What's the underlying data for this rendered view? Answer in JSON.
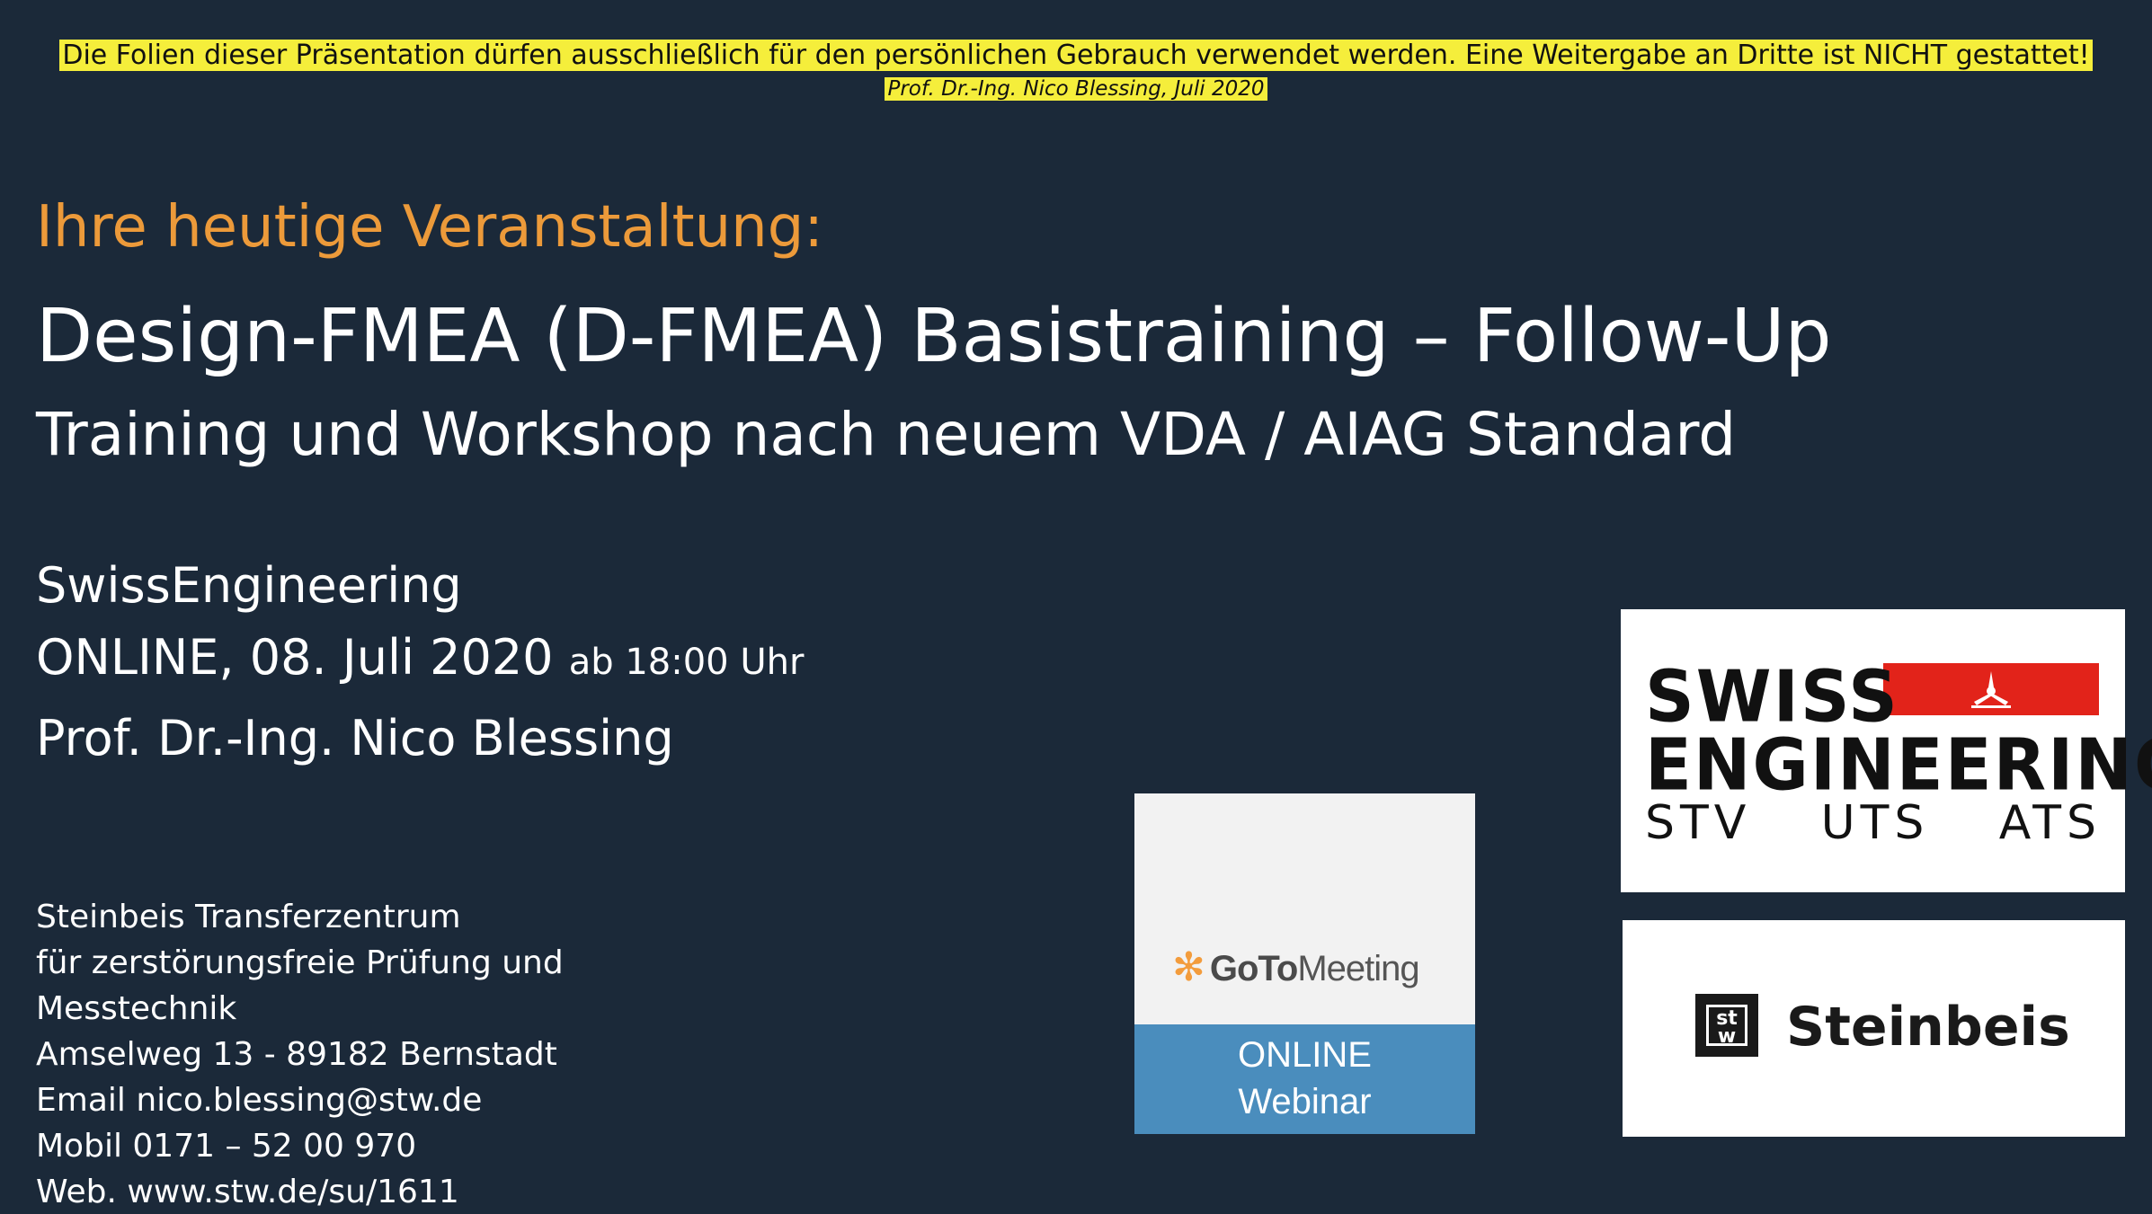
{
  "notice": {
    "line1": "Die Folien dieser Präsentation dürfen ausschließlich für den persönlichen Gebrauch verwendet werden. Eine Weitergabe an Dritte ist NICHT gestattet!",
    "line2": "Prof. Dr.-Ing. Nico Blessing, Juli 2020",
    "highlight_color": "#f5ee3b"
  },
  "header": {
    "intro": "Ihre heutige Veranstaltung:",
    "title": "Design-FMEA (D-FMEA) Basistraining – Follow-Up",
    "subtitle": "Training und Workshop nach neuem VDA / AIAG Standard"
  },
  "event": {
    "organizer": "SwissEngineering",
    "date": "ONLINE, 08. Juli 2020",
    "time": "ab 18:00 Uhr",
    "speaker": "Prof. Dr.-Ing. Nico Blessing"
  },
  "contact": {
    "lines": [
      "Steinbeis Transferzentrum",
      "für zerstörungsfreie Prüfung und",
      "Messtechnik",
      "Amselweg 13 - 89182 Bernstadt",
      "Email nico.blessing@stw.de",
      "Mobil 0171 – 52 00 970",
      "Web. www.stw.de/su/1611"
    ]
  },
  "goto": {
    "brand_bold": "GoTo",
    "brand_light": "Meeting",
    "band_line1": "ONLINE",
    "band_line2": "Webinar",
    "icon": "gotomeeting-flower-icon"
  },
  "swiss": {
    "line1": "SWISS",
    "line2": "ENGINEERING",
    "sub1": "STV",
    "sub2": "UTS",
    "sub3": "ATS",
    "icon": "propeller-icon"
  },
  "steinbeis": {
    "mark_line1": "st",
    "mark_line2": "w",
    "name": "Steinbeis"
  },
  "colors": {
    "background": "#1b2939",
    "accent_orange": "#ec9a3a",
    "swiss_red": "#e2231a",
    "webinar_blue": "#4a8dbd"
  }
}
